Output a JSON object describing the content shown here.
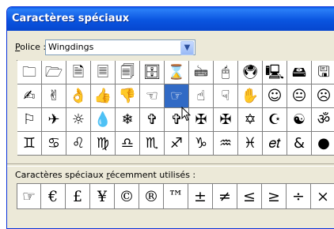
{
  "window": {
    "title": "Caractères spéciaux"
  },
  "font": {
    "label_prefix": "",
    "label_underlined": "P",
    "label_suffix": "olice :",
    "value": "Wingdings",
    "dropdown_icon": "chevron-down-icon"
  },
  "grid_rows": [
    [
      "🗀",
      "🗁",
      "🗎",
      "🗏",
      "🗐",
      "🗄",
      "⌛",
      "🖮",
      "🖰",
      "🖲",
      "🖳",
      "🖴",
      "🖫",
      "🖬"
    ],
    [
      "✍",
      "✌",
      "👌",
      "👍",
      "👎",
      "☜",
      "☞",
      "☝",
      "☟",
      "✋",
      "☺",
      "😐",
      "☹",
      "💣"
    ],
    [
      "⚐",
      "✈",
      "☼",
      "💧",
      "❄",
      "✞",
      "✞",
      "✠",
      "✠",
      "✡",
      "☪",
      "☯",
      "ॐ",
      "☸"
    ],
    [
      "♊",
      "♋",
      "♌",
      "♍",
      "♎",
      "♏",
      "♐",
      "♑",
      "♒",
      "♓",
      "𝑒𝑡",
      "&",
      "●",
      "❍"
    ]
  ],
  "selected": {
    "row": 1,
    "col": 6
  },
  "recent": {
    "label_prefix": "Caractères spéciaux ",
    "label_underlined": "r",
    "label_suffix": "écemment utilisés :",
    "items": [
      "☞",
      "€",
      "£",
      "¥",
      "©",
      "®",
      "™",
      "±",
      "≠",
      "≤",
      "≥",
      "÷",
      "×",
      "∞"
    ]
  },
  "colors": {
    "selection": "#316ac5",
    "title_bar": "#0a55e0"
  }
}
